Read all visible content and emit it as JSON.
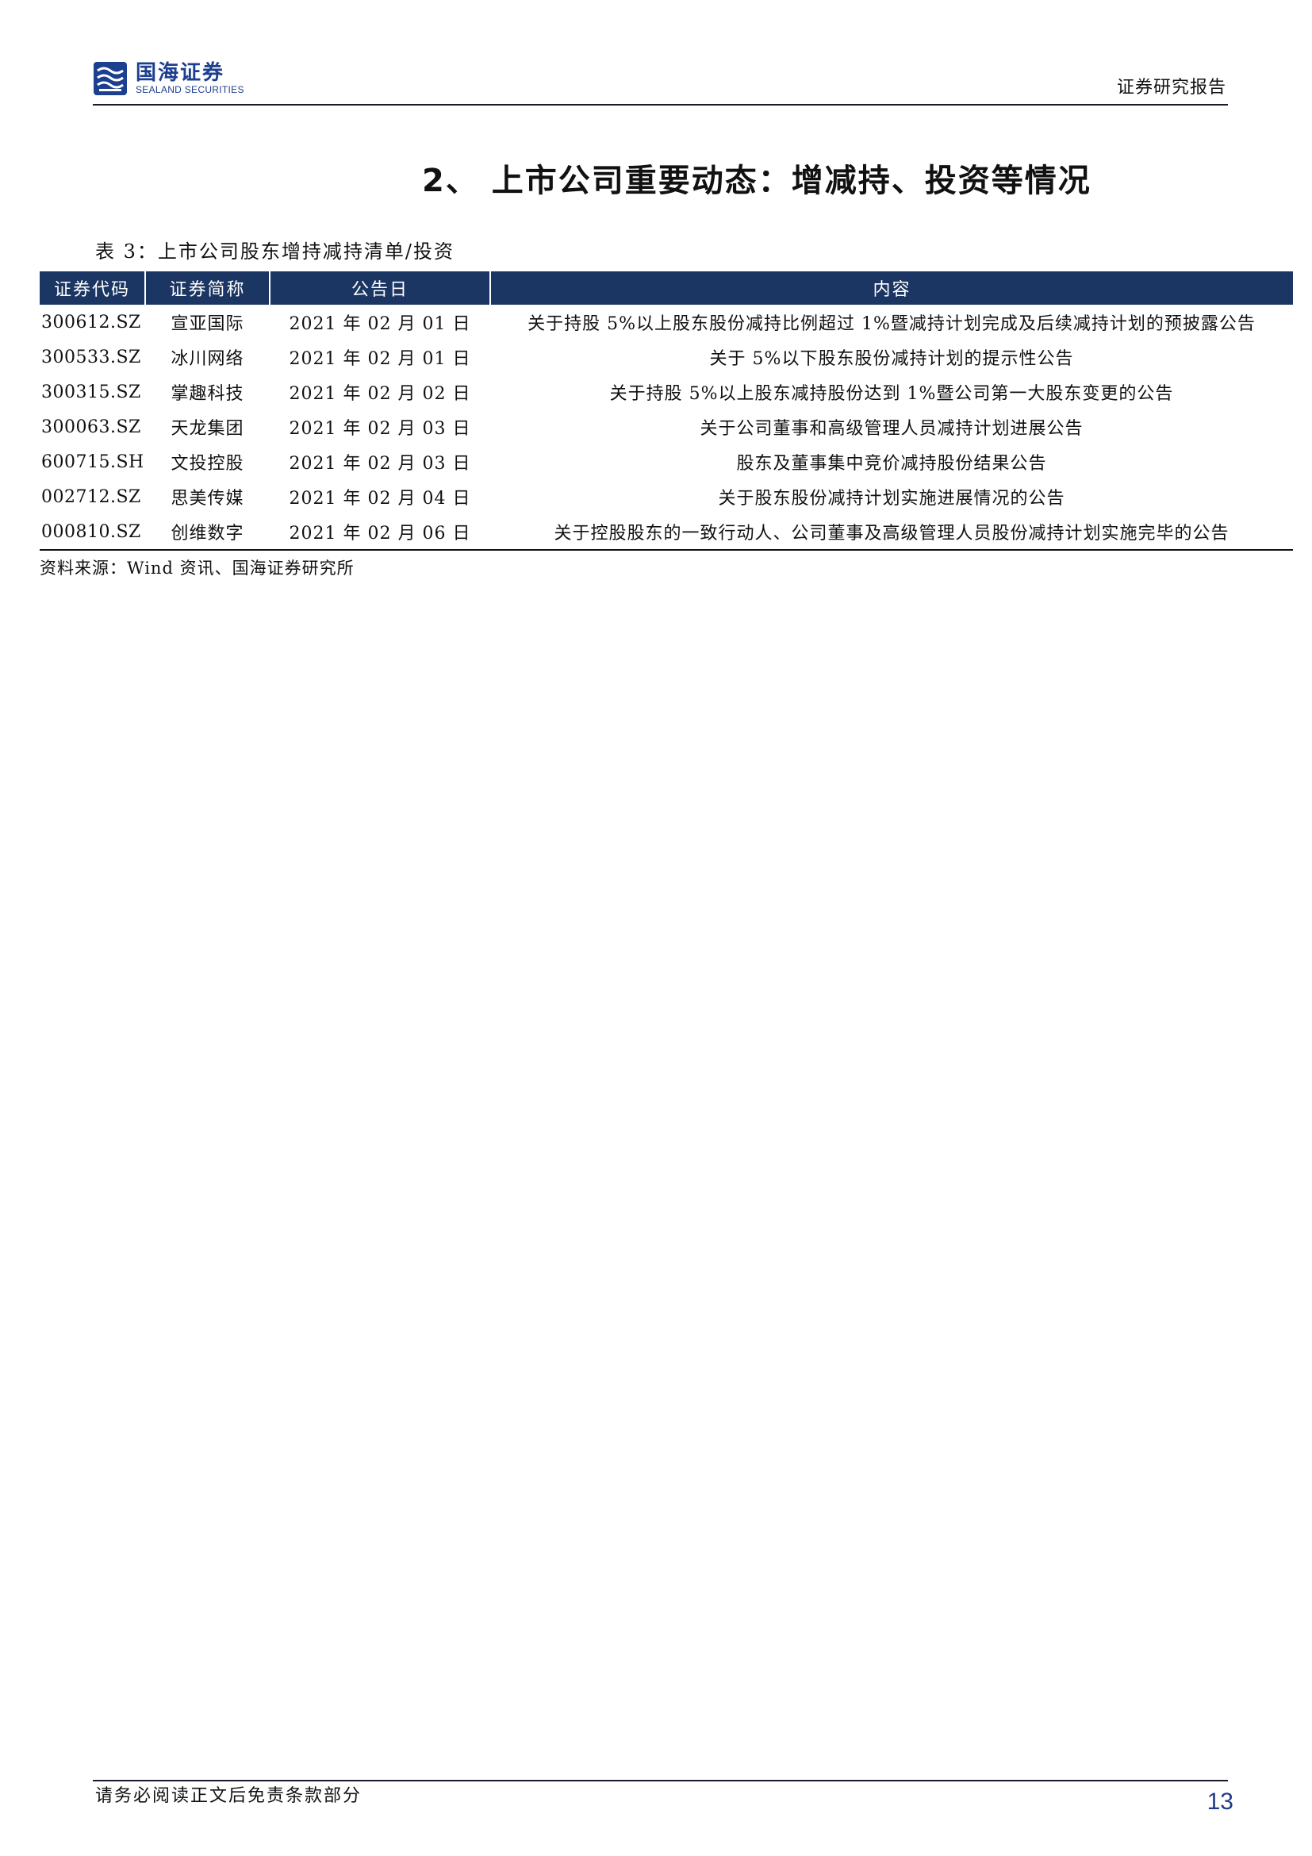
{
  "header": {
    "logo": {
      "cn": "国海证券",
      "en": "SEALAND SECURITIES",
      "icon": "sealand-logo-icon"
    },
    "report_type": "证券研究报告"
  },
  "section_title": "2、 上市公司重要动态：增减持、投资等情况",
  "table": {
    "caption": "表 3：上市公司股东增持减持清单/投资",
    "columns": {
      "code": "证券代码",
      "name": "证券简称",
      "date": "公告日",
      "content": "内容"
    },
    "rows": [
      {
        "code": "300612.SZ",
        "name": "宣亚国际",
        "date": "2021 年 02 月 01 日",
        "content": "关于持股 5%以上股东股份减持比例超过 1%暨减持计划完成及后续减持计划的预披露公告"
      },
      {
        "code": "300533.SZ",
        "name": "冰川网络",
        "date": "2021 年 02 月 01 日",
        "content": "关于 5%以下股东股份减持计划的提示性公告"
      },
      {
        "code": "300315.SZ",
        "name": "掌趣科技",
        "date": "2021 年 02 月 02 日",
        "content": "关于持股 5%以上股东减持股份达到 1%暨公司第一大股东变更的公告"
      },
      {
        "code": "300063.SZ",
        "name": "天龙集团",
        "date": "2021 年 02 月 03 日",
        "content": "关于公司董事和高级管理人员减持计划进展公告"
      },
      {
        "code": "600715.SH",
        "name": "文投控股",
        "date": "2021 年 02 月 03 日",
        "content": "股东及董事集中竞价减持股份结果公告"
      },
      {
        "code": "002712.SZ",
        "name": "思美传媒",
        "date": "2021 年 02 月 04 日",
        "content": "关于股东股份减持计划实施进展情况的公告"
      },
      {
        "code": "000810.SZ",
        "name": "创维数字",
        "date": "2021 年 02 月 06 日",
        "content": "关于控股股东的一致行动人、公司董事及高级管理人员股份减持计划实施完毕的公告"
      }
    ],
    "source": "资料来源：Wind 资讯、国海证券研究所"
  },
  "footer": {
    "disclaimer": "请务必阅读正文后免责条款部分",
    "page_number": "13"
  },
  "colors": {
    "brand_blue": "#1d3f8f",
    "table_header_bg": "#1c3663",
    "page_number": "#1f3c88"
  }
}
